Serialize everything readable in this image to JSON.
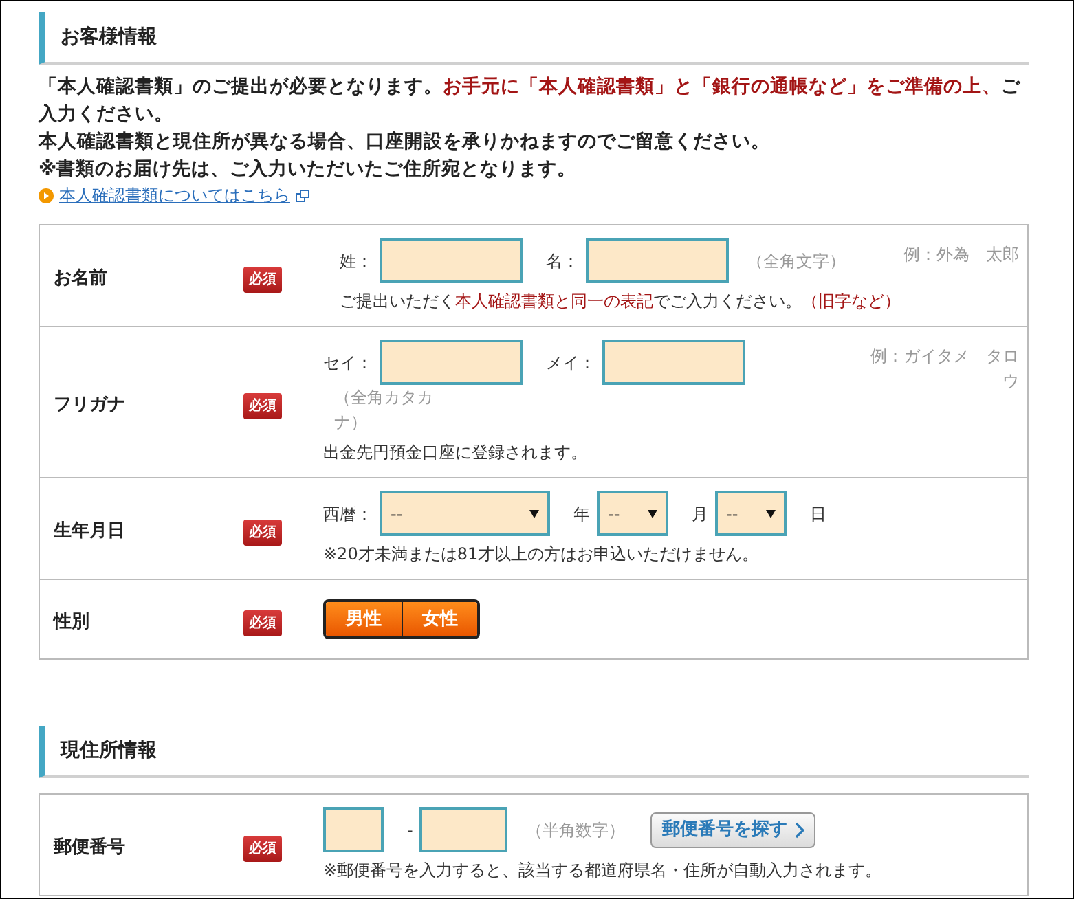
{
  "sections": [
    {
      "title": "お客様情報",
      "intro": [
        [
          {
            "text": "「本人確認書類」のご提出が必要となります。",
            "emphasis": false
          },
          {
            "text": "お手元に「本人確認書類」と「銀行の通帳など」をご準備の上、",
            "emphasis": true
          },
          {
            "text": "ご入力ください。",
            "emphasis": false
          }
        ],
        [
          {
            "text": "本人確認書類と現住所が異なる場合、口座開設を承りかねますのでご留意ください。",
            "emphasis": false
          }
        ],
        [
          {
            "text": "※書類のお届け先は、ご入力いただいたご住所宛となります。",
            "emphasis": false
          }
        ]
      ],
      "link": "本人確認書類についてはこちら",
      "rows": [
        {
          "label": "お名前",
          "required": "必須",
          "example": "例：外為　太郎",
          "lines": [
            [
              {
                "kind": "text",
                "text": "姓："
              },
              {
                "kind": "input"
              },
              {
                "kind": "text",
                "text": "名："
              },
              {
                "kind": "input"
              },
              {
                "kind": "hint",
                "text": "（全角文字）"
              }
            ],
            [
              {
                "kind": "note",
                "segments": [
                  {
                    "text": "ご提出いただく",
                    "emphasis": false
                  },
                  {
                    "text": "本人確認書類と同一の表記",
                    "emphasis": true
                  },
                  {
                    "text": "でご入力ください。",
                    "emphasis": false
                  },
                  {
                    "text": "（旧字など）",
                    "emphasis": true
                  }
                ]
              }
            ]
          ]
        },
        {
          "label": "フリガナ",
          "required": "必須",
          "example": "例：ガイタメ　タロウ",
          "lines": [
            [
              {
                "kind": "text",
                "text": "セイ："
              },
              {
                "kind": "input"
              },
              {
                "kind": "text",
                "text": "メイ："
              },
              {
                "kind": "input"
              },
              {
                "kind": "hint",
                "text": "（全角カタカナ）"
              }
            ],
            [
              {
                "kind": "note",
                "segments": [
                  {
                    "text": "出金先円預金口座に登録されます。",
                    "emphasis": false
                  }
                ]
              }
            ]
          ]
        },
        {
          "label": "生年月日",
          "required": "必須",
          "lines": [
            [
              {
                "kind": "text",
                "text": "西暦："
              },
              {
                "kind": "select",
                "value": "--"
              },
              {
                "kind": "text",
                "text": "年"
              },
              {
                "kind": "select",
                "value": "--"
              },
              {
                "kind": "text",
                "text": "月"
              },
              {
                "kind": "select",
                "value": "--"
              },
              {
                "kind": "text",
                "text": "日"
              }
            ],
            [
              {
                "kind": "note",
                "segments": [
                  {
                    "text": "※20才未満または81才以上の方はお申込いただけません。",
                    "emphasis": false
                  }
                ]
              }
            ]
          ]
        },
        {
          "label": "性別",
          "required": "必須",
          "lines": [
            [
              {
                "kind": "toggle",
                "options": [
                  {
                    "label": "男性",
                    "selected": false
                  },
                  {
                    "label": "女性",
                    "selected": false
                  }
                ]
              }
            ]
          ]
        }
      ]
    },
    {
      "title": "現住所情報",
      "rows": [
        {
          "label": "郵便番号",
          "required": "必須",
          "lines": [
            [
              {
                "kind": "input"
              },
              {
                "kind": "text",
                "text": "-"
              },
              {
                "kind": "input"
              },
              {
                "kind": "hint",
                "text": "（半角数字）"
              },
              {
                "kind": "button",
                "text": "郵便番号を探す"
              }
            ],
            [
              {
                "kind": "note",
                "segments": [
                  {
                    "text": "※郵便番号を入力すると、該当する都道府県名・住所が自動入力されます。",
                    "emphasis": false
                  }
                ]
              }
            ]
          ]
        }
      ]
    }
  ]
}
